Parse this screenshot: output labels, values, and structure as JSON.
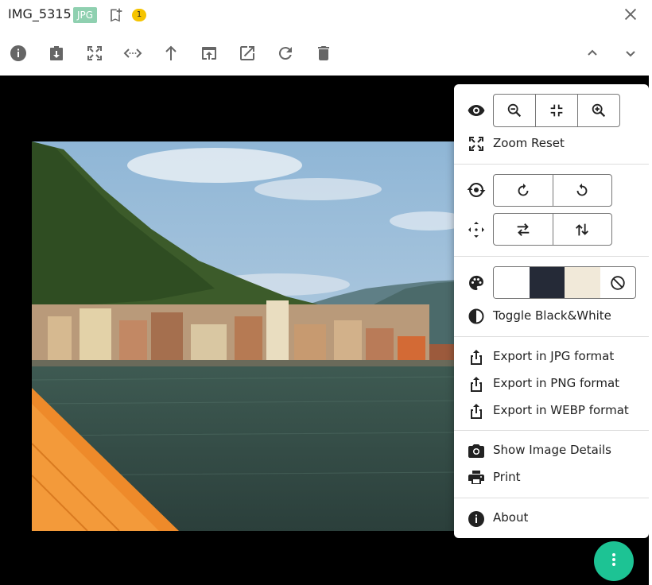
{
  "header": {
    "title": "IMG_5315",
    "format_badge": "JPG",
    "count": "1"
  },
  "toolbar": {
    "icons": [
      "info-icon",
      "download-icon",
      "fullscreen-icon",
      "code-icon",
      "upload-icon",
      "open-in-browser-icon",
      "open-external-icon",
      "refresh-icon",
      "delete-icon",
      "chevron-up-icon",
      "chevron-down-icon"
    ]
  },
  "menu": {
    "zoom_reset": "Zoom Reset",
    "toggle_bw": "Toggle Black&White",
    "export_jpg": "Export in JPG format",
    "export_png": "Export in PNG format",
    "export_webp": "Export in WEBP format",
    "show_details": "Show Image Details",
    "print": "Print",
    "about": "About",
    "background_colors": [
      "#ffffff",
      "#252a37",
      "#f1e9d9"
    ]
  },
  "colors": {
    "accent": "#1dc394",
    "badge_jpg": "#8fd0b0",
    "badge_count": "#f5c400"
  }
}
